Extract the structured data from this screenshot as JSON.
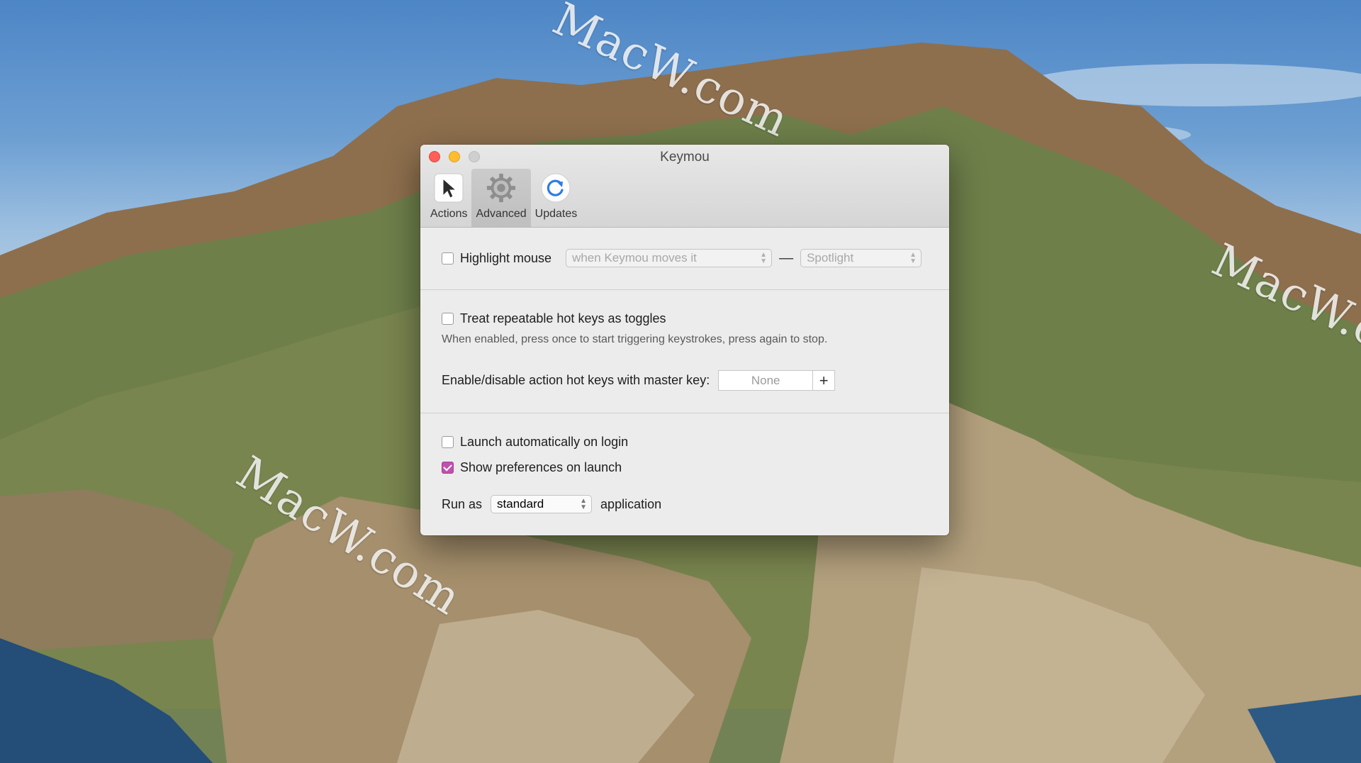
{
  "window": {
    "title": "Keymou"
  },
  "toolbar": {
    "items": [
      {
        "label": "Actions",
        "icon": "cursor-icon"
      },
      {
        "label": "Advanced",
        "icon": "gear-icon",
        "selected": true
      },
      {
        "label": "Updates",
        "icon": "refresh-icon"
      }
    ]
  },
  "highlight": {
    "label": "Highlight mouse",
    "checked": false,
    "when_value": "when Keymou moves it",
    "style_value": "Spotlight",
    "separator": "—"
  },
  "toggles": {
    "label": "Treat repeatable hot keys as toggles",
    "checked": false,
    "hint": "When enabled, press once to start triggering keystrokes, press again to stop."
  },
  "master_key": {
    "label": "Enable/disable action hot keys with master key:",
    "value": "None",
    "add_label": "+"
  },
  "launch": {
    "login_label": "Launch automatically on login",
    "login_checked": false,
    "prefs_label": "Show preferences on launch",
    "prefs_checked": true
  },
  "run_as": {
    "prefix": "Run as",
    "value": "standard",
    "suffix": "application"
  },
  "watermarks": [
    "MacW.com",
    "MacW.com",
    "MacW.com"
  ],
  "colors": {
    "accent_checkbox": "#c24fb0",
    "close": "#fe5f57",
    "minimize": "#febc2e"
  }
}
